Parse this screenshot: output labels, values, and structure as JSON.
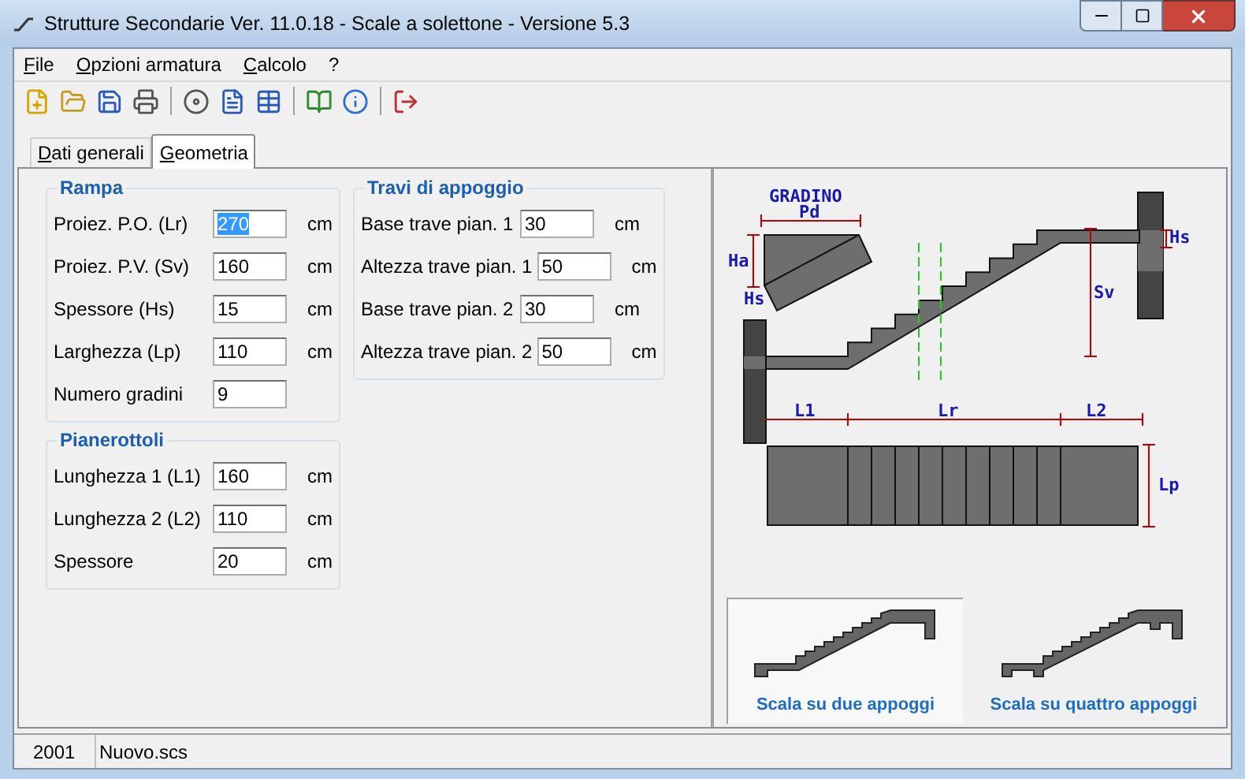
{
  "window": {
    "title": "Strutture Secondarie Ver. 11.0.18 - Scale a solettone - Versione 5.3"
  },
  "menu": [
    "File",
    "Opzioni armatura",
    "Calcolo",
    "?"
  ],
  "tabs": [
    {
      "label": "Dati generali",
      "selected": false
    },
    {
      "label": "Geometria",
      "selected": true
    }
  ],
  "groups": [
    {
      "title": "Rampa",
      "fields": [
        {
          "label": "Proiez. P.O. (Lr)",
          "value": "270",
          "unit": "cm",
          "focused": true
        },
        {
          "label": "Proiez. P.V. (Sv)",
          "value": "160",
          "unit": "cm",
          "focused": false
        },
        {
          "label": "Spessore (Hs)",
          "value": "15",
          "unit": "cm",
          "focused": false
        },
        {
          "label": "Larghezza (Lp)",
          "value": "110",
          "unit": "cm",
          "focused": false
        },
        {
          "label": "Numero gradini",
          "value": "9",
          "focused": false
        }
      ]
    },
    {
      "title": "Travi di appoggio",
      "fields": [
        {
          "label": "Base trave pian. 1",
          "value": "30",
          "unit": "cm",
          "focused": false
        },
        {
          "label": "Altezza trave pian. 1",
          "value": "50",
          "unit": "cm",
          "focused": false
        },
        {
          "label": "Base trave pian. 2",
          "value": "30",
          "unit": "cm",
          "focused": false
        },
        {
          "label": "Altezza trave pian. 2",
          "value": "50",
          "unit": "cm",
          "focused": false
        }
      ]
    },
    {
      "title": "Pianerottoli",
      "fields": [
        {
          "label": "Lunghezza 1 (L1)",
          "value": "160",
          "unit": "cm",
          "focused": false
        },
        {
          "label": "Lunghezza 2 (L2)",
          "value": "110",
          "unit": "cm",
          "focused": false
        },
        {
          "label": "Spessore",
          "value": "20",
          "unit": "cm",
          "focused": false
        }
      ]
    }
  ],
  "diagram": {
    "step_title": "GRADINO",
    "pd": "Pd",
    "ha": "Ha",
    "hs_step": "Hs",
    "sv": "Sv",
    "hs_beam": "Hs",
    "l1": "L1",
    "lr": "Lr",
    "l2": "L2",
    "lp": "Lp"
  },
  "stair_types": [
    {
      "label": "Scala su due appoggi",
      "kind": "two_supports",
      "selected": true
    },
    {
      "label": "Scala su quattro appoggi",
      "kind": "four_supports",
      "selected": false
    }
  ],
  "status_bar": [
    "2001",
    "Nuovo.scs"
  ]
}
